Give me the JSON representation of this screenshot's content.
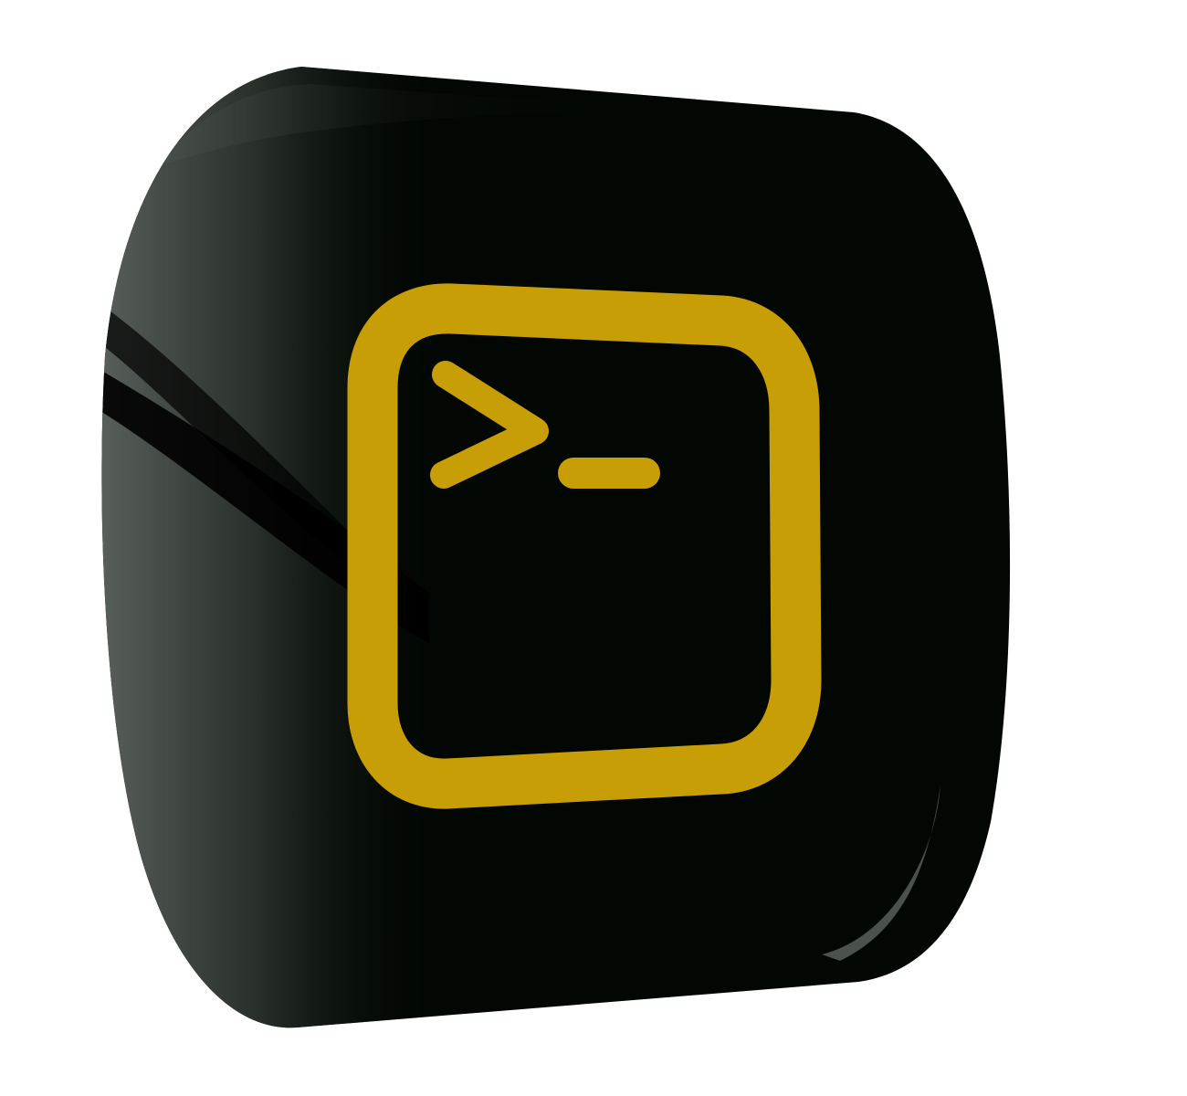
{
  "icon": {
    "name": "terminal-app-icon",
    "symbol": "terminal-prompt-icon",
    "glyph": ">_"
  },
  "colors": {
    "background": "#ffffff",
    "key_body": "#020703",
    "key_highlight": "#5c625e",
    "symbol": "#c79e05"
  }
}
